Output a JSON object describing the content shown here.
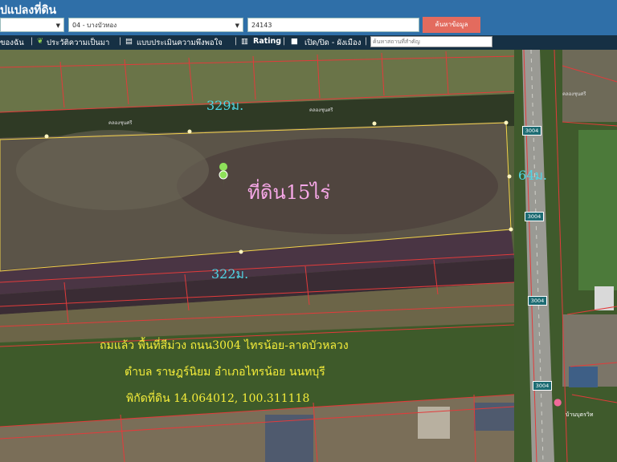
{
  "header": {
    "title": "ปแปลงที่ดิน",
    "province_select": "",
    "district_select": "04 - บางบัวทอง",
    "parcel_input": "24143",
    "search_button": "ค้นหาข้อมูล"
  },
  "toolbar": {
    "item1": "ของฉัน",
    "item2": "ประวัติความเป็นมา",
    "item3": "แบบประเมินความพึงพอใจ",
    "item4": "Rating",
    "item5": "เปิด/ปิด - ผังเมือง",
    "place_placeholder": "ค้นหาสถานที่สำคัญ"
  },
  "map": {
    "plot_label": "ที่ดิน15ไร่",
    "top_length": "329ม.",
    "bottom_length": "322ม.",
    "side_length": "64ม.",
    "canal_label_1": "คลองชุนศรี",
    "canal_label_2": "คลองชุนศรี",
    "canal_label_3": "คลองชุนศรี",
    "road_badge_1": "3004",
    "road_badge_2": "3004",
    "road_badge_3": "3004",
    "road_badge_4": "3004",
    "poi_label": "บ้านบุตรวิท",
    "desc_line1": "ถมแล้ว พื้นที่สีม่วง ถนน3004 ไทรน้อย-ลาดบัวหลวง",
    "desc_line2": "ตำบล ราษฎร์นิยม อำเภอไทรน้อย นนทบุรี",
    "desc_line3": "พิกัดที่ดิน 14.064012, 100.311118"
  },
  "colors": {
    "header_bg": "#2f6fa8",
    "toolbar_bg": "#163044",
    "button_bg": "#e36b5e",
    "parcel_line": "#e23b3b",
    "plot_outline": "#f2d24a",
    "measure_text": "#4fd6e6",
    "plot_text": "#f7a8e8",
    "desc_text": "#f4ec3a"
  }
}
